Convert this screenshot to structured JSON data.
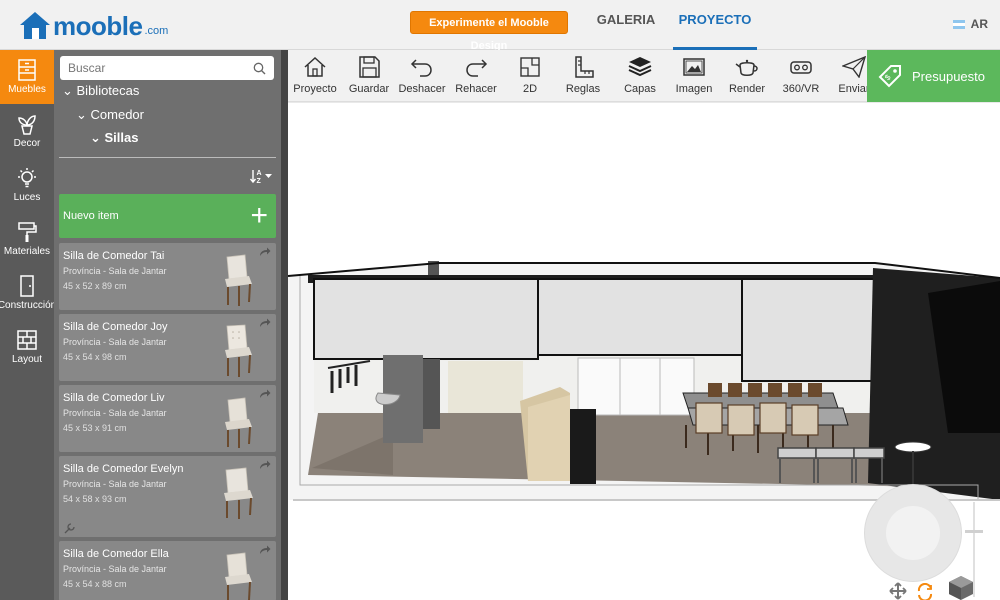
{
  "header": {
    "logo_word": "mooble",
    "logo_suffix": ".com",
    "cta_label": "Experimente el Mooble Design",
    "tabs": [
      {
        "label": "GALERIA",
        "active": false
      },
      {
        "label": "PROYECTO",
        "active": true
      }
    ],
    "language": "AR"
  },
  "rail": {
    "items": [
      {
        "label": "Muebles",
        "icon": "wardrobe-icon",
        "active": true
      },
      {
        "label": "Decor",
        "icon": "plant-icon",
        "active": false
      },
      {
        "label": "Luces",
        "icon": "bulb-icon",
        "active": false
      },
      {
        "label": "Materiales",
        "icon": "paint-roller-icon",
        "active": false
      },
      {
        "label": "Construcción",
        "icon": "door-icon",
        "active": false
      },
      {
        "label": "Layout",
        "icon": "brick-icon",
        "active": false
      }
    ]
  },
  "catalog": {
    "search_placeholder": "Buscar",
    "tree": [
      "Bibliotecas",
      "Comedor",
      "Sillas"
    ],
    "new_item_label": "Nuevo item",
    "items": [
      {
        "title": "Silla de Comedor Tai",
        "category": "Província - Sala de Jantar",
        "dimensions": "45 x 52 x 89 cm"
      },
      {
        "title": "Silla de Comedor Joy",
        "category": "Província - Sala de Jantar",
        "dimensions": "45 x 54 x 98 cm"
      },
      {
        "title": "Silla de Comedor Liv",
        "category": "Província - Sala de Jantar",
        "dimensions": "45 x 53 x 91 cm"
      },
      {
        "title": "Silla de Comedor Evelyn",
        "category": "Província - Sala de Jantar",
        "dimensions": "54 x 58 x 93 cm"
      },
      {
        "title": "Silla de Comedor Ella",
        "category": "Província - Sala de Jantar",
        "dimensions": "45 x 54 x 88 cm"
      }
    ]
  },
  "toolbar": {
    "tools": [
      {
        "label": "Proyecto",
        "icon": "house-icon"
      },
      {
        "label": "Guardar",
        "icon": "floppy-icon"
      },
      {
        "label": "Deshacer",
        "icon": "undo-icon"
      },
      {
        "label": "Rehacer",
        "icon": "redo-icon"
      },
      {
        "label": "2D",
        "icon": "plan-2d-icon"
      },
      {
        "label": "Reglas",
        "icon": "ruler-icon"
      },
      {
        "label": "Capas",
        "icon": "layers-icon"
      },
      {
        "label": "Imagen",
        "icon": "image-icon"
      },
      {
        "label": "Render",
        "icon": "teapot-icon"
      },
      {
        "label": "360/VR",
        "icon": "vr-headset-icon"
      },
      {
        "label": "Enviar",
        "icon": "paper-plane-icon"
      }
    ],
    "quote_label": "Presupuesto"
  },
  "colors": {
    "brand_blue": "#1b6fb8",
    "accent_orange": "#f5890f",
    "accent_green": "#5cb85c"
  }
}
